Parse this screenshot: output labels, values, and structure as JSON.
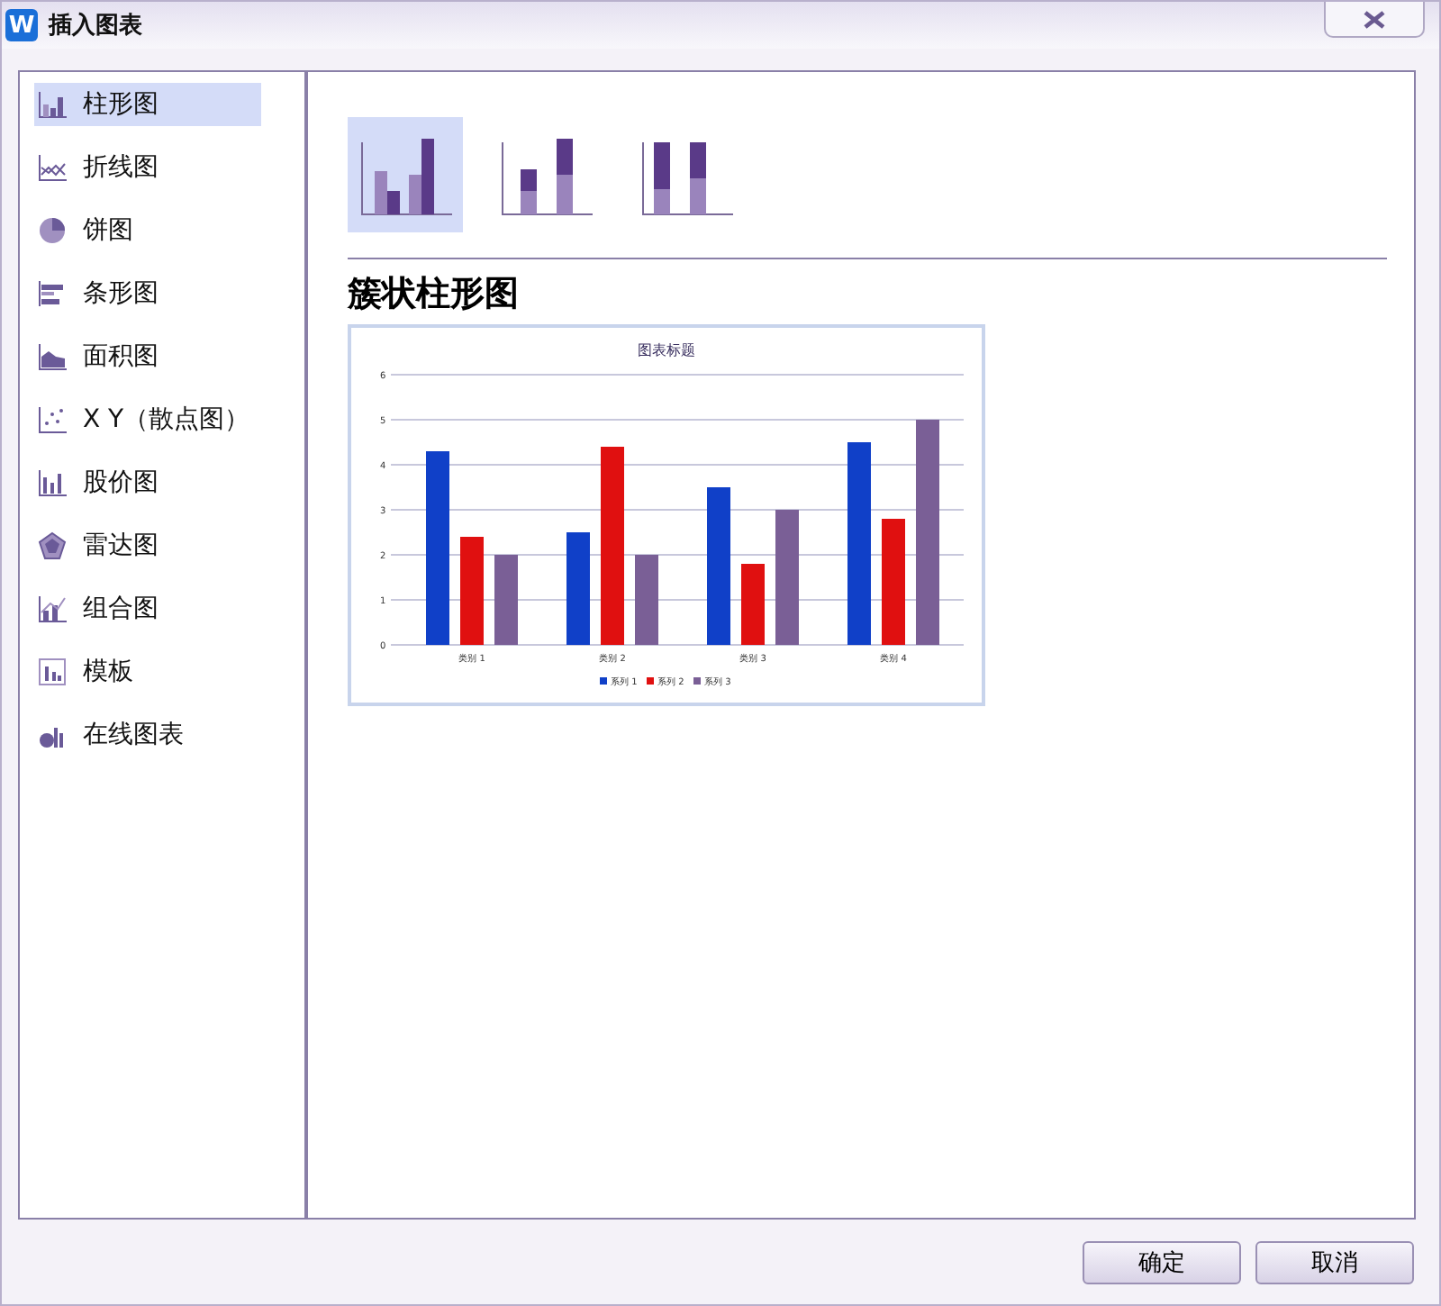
{
  "window": {
    "app_icon": "W",
    "title": "插入图表"
  },
  "sidebar": {
    "items": [
      {
        "label": "柱形图",
        "kind": "column",
        "selected": true
      },
      {
        "label": "折线图",
        "kind": "line",
        "selected": false
      },
      {
        "label": "饼图",
        "kind": "pie",
        "selected": false
      },
      {
        "label": "条形图",
        "kind": "bar",
        "selected": false
      },
      {
        "label": "面积图",
        "kind": "area",
        "selected": false
      },
      {
        "label": "X Y（散点图）",
        "kind": "scatter",
        "selected": false
      },
      {
        "label": "股价图",
        "kind": "stock",
        "selected": false
      },
      {
        "label": "雷达图",
        "kind": "radar",
        "selected": false
      },
      {
        "label": "组合图",
        "kind": "combo",
        "selected": false
      },
      {
        "label": "模板",
        "kind": "template",
        "selected": false
      },
      {
        "label": "在线图表",
        "kind": "online",
        "selected": false
      }
    ]
  },
  "subtypes": [
    {
      "kind": "clustered",
      "selected": true
    },
    {
      "kind": "stacked",
      "selected": false
    },
    {
      "kind": "percent",
      "selected": false
    }
  ],
  "subtype_title": "簇状柱形图",
  "preview": {
    "chart_data": {
      "type": "bar",
      "title": "图表标题",
      "categories": [
        "类别 1",
        "类别 2",
        "类别 3",
        "类别 4"
      ],
      "series": [
        {
          "name": "系列 1",
          "color": "#1040c8",
          "values": [
            4.3,
            2.5,
            3.5,
            4.5
          ]
        },
        {
          "name": "系列 2",
          "color": "#e01010",
          "values": [
            2.4,
            4.4,
            1.8,
            2.8
          ]
        },
        {
          "name": "系列 3",
          "color": "#7a5f96",
          "values": [
            2,
            2,
            3,
            5
          ]
        }
      ],
      "ylim": [
        0,
        6
      ],
      "yticks": [
        0,
        1,
        2,
        3,
        4,
        5,
        6
      ],
      "grid": true,
      "legend": true
    }
  },
  "buttons": [
    {
      "label": "确定"
    },
    {
      "label": "取消"
    }
  ]
}
